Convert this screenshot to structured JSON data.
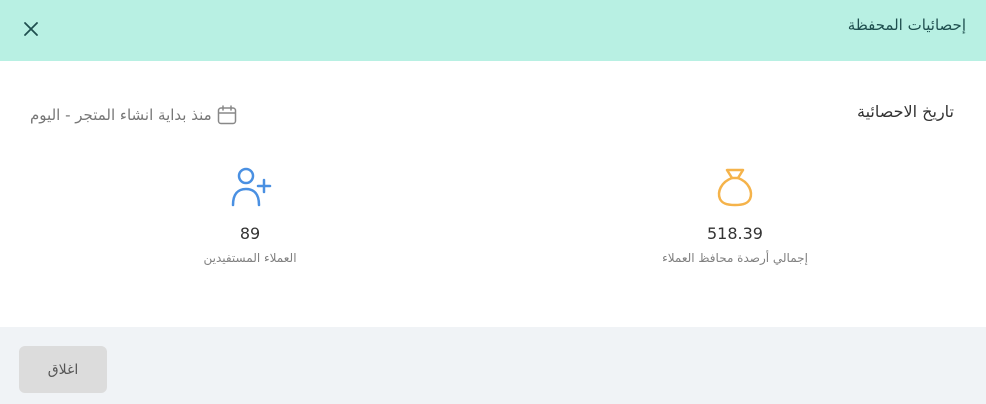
{
  "header": {
    "title": "إحصائيات المحفظة",
    "close_icon": "close-icon"
  },
  "date": {
    "label": "تاريخ الاحصائية",
    "range_text": "منذ بداية انشاء المتجر - اليوم",
    "icon": "calendar-icon"
  },
  "stats": {
    "total_balances": {
      "value": "518.39",
      "label": "إجمالي أرصدة محافظ العملاء",
      "icon": "money-bag-icon",
      "color": "#f5b34a"
    },
    "beneficiaries": {
      "value": "89",
      "label": "العملاء المستفيدين",
      "icon": "user-plus-icon",
      "color": "#4a90e2"
    }
  },
  "footer": {
    "close_label": "اغلاق"
  },
  "colors": {
    "header_bg": "#b8f0e3",
    "footer_bg": "#f0f3f6",
    "button_bg": "#dcdcdc"
  }
}
